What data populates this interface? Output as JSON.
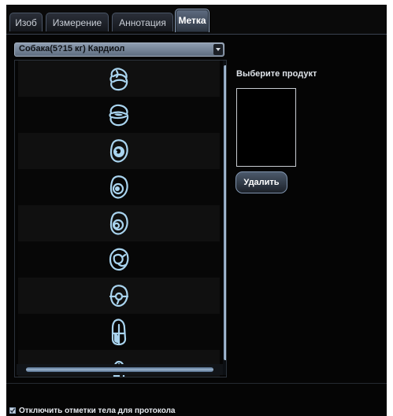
{
  "tabs": [
    {
      "label": "Изоб",
      "active": false
    },
    {
      "label": "Измерение",
      "active": false
    },
    {
      "label": "Аннотация",
      "active": false
    },
    {
      "label": "Метка",
      "active": true
    }
  ],
  "preset": {
    "selected": "Собака(5?15 кг) Кардиол"
  },
  "body_marks": [
    {
      "icon": "heart-long-axis-icon"
    },
    {
      "icon": "heart-long-axis-variant-icon"
    },
    {
      "icon": "heart-short-axis-icon"
    },
    {
      "icon": "heart-short-axis-small-icon"
    },
    {
      "icon": "heart-short-axis-offset-icon"
    },
    {
      "icon": "heart-apical-view-icon"
    },
    {
      "icon": "heart-transducer-view-icon"
    },
    {
      "icon": "heart-four-chamber-icon"
    },
    {
      "icon": "heart-partial-icon"
    }
  ],
  "product_panel": {
    "label": "Выберите продукт"
  },
  "delete_label": "Удалить",
  "protocol_option": {
    "label": "Отключить отметки тела для протокола",
    "checked": true
  },
  "colors": {
    "accent": "#a9d4ef",
    "tab_active": "#5f6d82",
    "background": "#050505"
  }
}
